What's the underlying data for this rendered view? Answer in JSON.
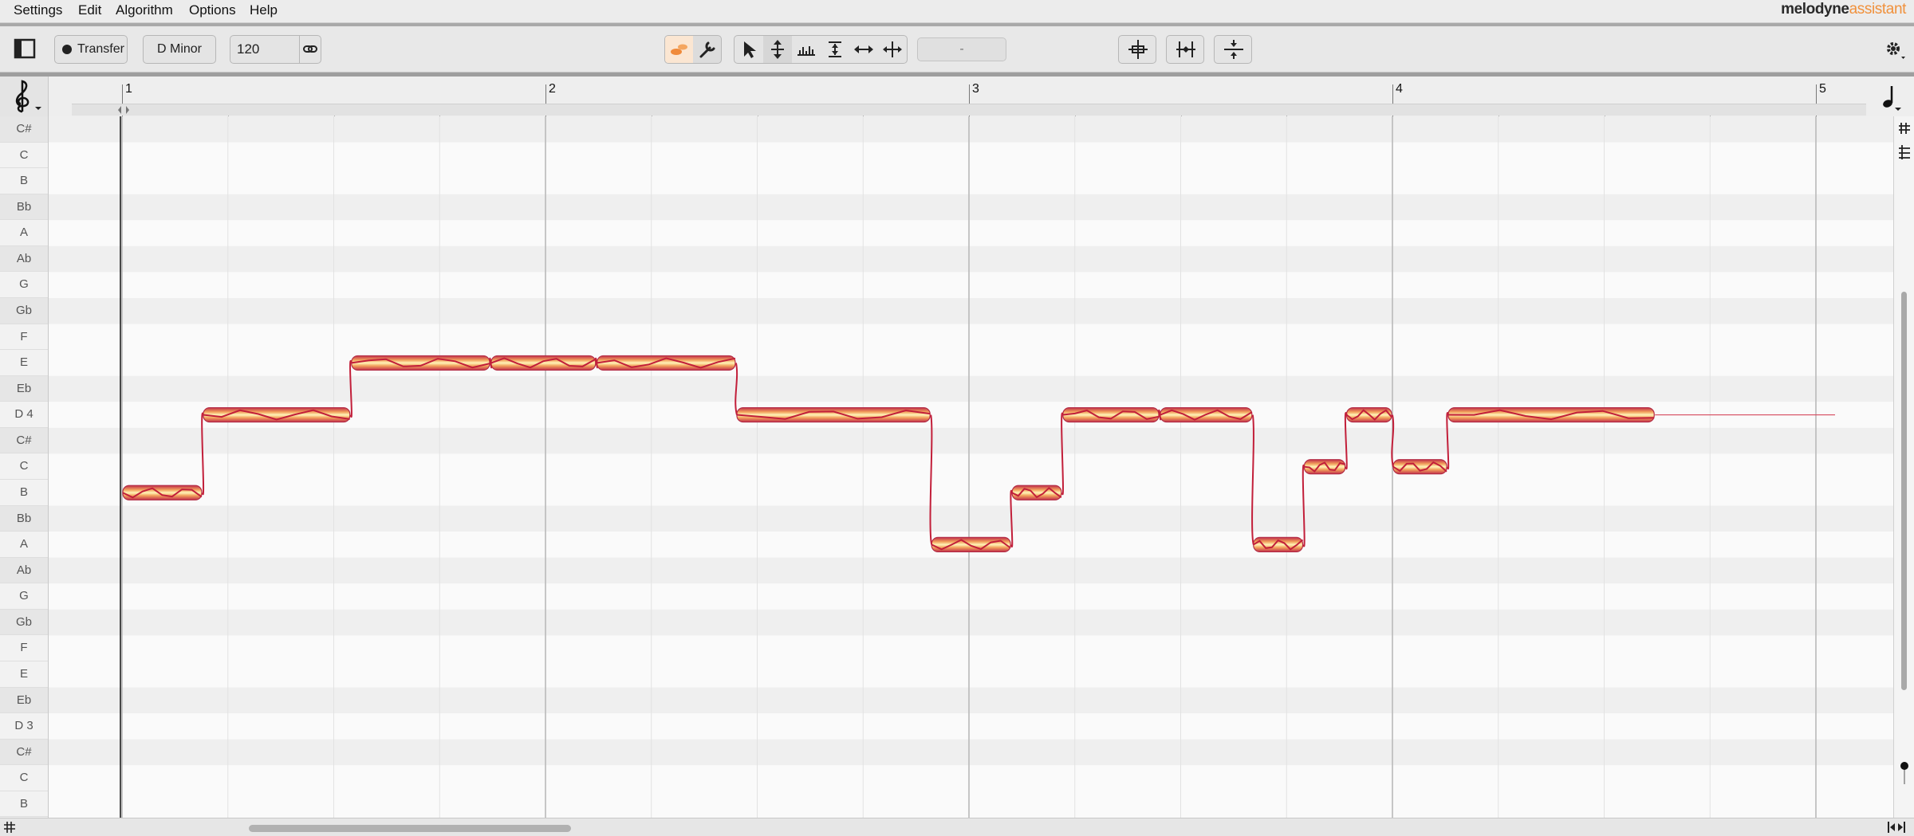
{
  "menu": [
    "Settings",
    "Edit",
    "Algorithm",
    "Options",
    "Help"
  ],
  "brand": {
    "main": "melodyne",
    "sub": "assistant",
    "accent_color": "#f0913c"
  },
  "toolbar": {
    "transfer_label": "Transfer",
    "key_label": "D Minor",
    "tempo_value": "120",
    "center_field": "-",
    "tools": [
      "blob-tool-icon",
      "macro-tool-icon",
      "pointer-tool-icon",
      "pitch-tool-icon",
      "amplitude-tool-icon",
      "formant-tool-icon",
      "time-tool-icon",
      "note-separation-tool-icon"
    ],
    "right_tools": [
      "pitch-center-icon",
      "quantize-time-icon",
      "pitch-drift-icon"
    ]
  },
  "ruler": {
    "bars": [
      "1",
      "2",
      "3",
      "4",
      "5"
    ]
  },
  "pitch_labels": [
    "C#",
    "C",
    "B",
    "Bb",
    "A",
    "Ab",
    "G",
    "Gb",
    "F",
    "E",
    "Eb",
    "D 4",
    "C#",
    "C",
    "B",
    "Bb",
    "A",
    "Ab",
    "G",
    "Gb",
    "F",
    "E",
    "Eb",
    "D 3",
    "C#",
    "C",
    "B"
  ],
  "notes": [
    {
      "pitch": "B3",
      "start": 1.0,
      "end": 1.19
    },
    {
      "pitch": "D4",
      "start": 1.19,
      "end": 1.54
    },
    {
      "pitch": "E4",
      "start": 1.54,
      "end": 1.87
    },
    {
      "pitch": "E4",
      "start": 1.87,
      "end": 2.12
    },
    {
      "pitch": "E4",
      "start": 2.12,
      "end": 2.45
    },
    {
      "pitch": "D4",
      "start": 2.45,
      "end": 2.91
    },
    {
      "pitch": "A3",
      "start": 2.91,
      "end": 3.1
    },
    {
      "pitch": "B3",
      "start": 3.1,
      "end": 3.22
    },
    {
      "pitch": "D4",
      "start": 3.22,
      "end": 3.45
    },
    {
      "pitch": "D4",
      "start": 3.45,
      "end": 3.67
    },
    {
      "pitch": "A3",
      "start": 3.67,
      "end": 3.79
    },
    {
      "pitch": "C4",
      "start": 3.79,
      "end": 3.89
    },
    {
      "pitch": "D4",
      "start": 3.89,
      "end": 4.0
    },
    {
      "pitch": "C4",
      "start": 4.0,
      "end": 4.13
    },
    {
      "pitch": "D4",
      "start": 4.13,
      "end": 4.62
    }
  ]
}
